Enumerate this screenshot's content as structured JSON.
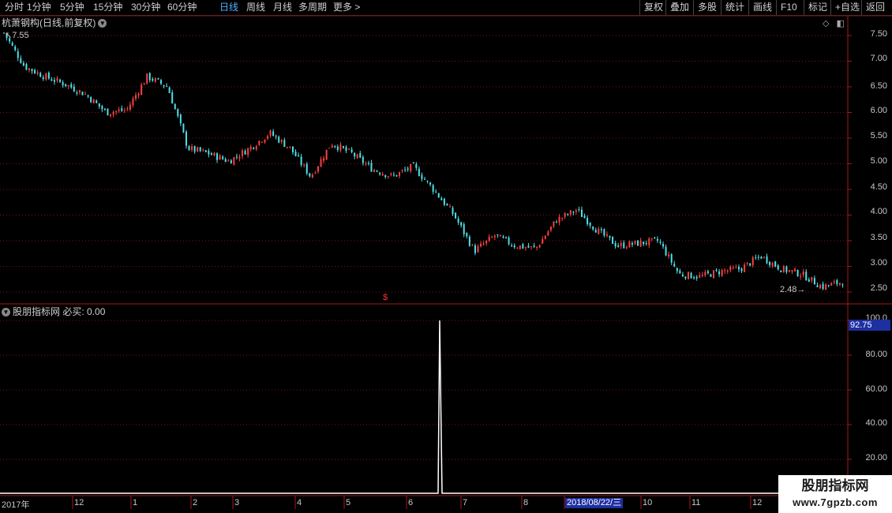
{
  "toolbar": {
    "periods": [
      "分时",
      "1分钟",
      "5分钟",
      "15分钟",
      "30分钟",
      "60分钟",
      "日线",
      "周线",
      "月线",
      "多周期",
      "更多 >"
    ],
    "active_period": "日线",
    "right_buttons": [
      "复权",
      "叠加",
      "多股",
      "统计",
      "画线",
      "F10",
      "标记",
      "+自选",
      "返回"
    ]
  },
  "main_chart": {
    "title": "杭萧钢构(日线,前复权)",
    "high_label": "7.55",
    "low_label": "2.48",
    "price_ticks": [
      "7.50",
      "7.00",
      "6.50",
      "6.00",
      "5.50",
      "5.00",
      "4.50",
      "4.00",
      "3.50",
      "3.00",
      "2.50"
    ],
    "marker": "$"
  },
  "indicator": {
    "title": "股朋指标网",
    "param": "必买: 0.00",
    "current_value": "92.75",
    "ticks": [
      "100.0",
      "80.00",
      "60.00",
      "40.00",
      "20.00"
    ]
  },
  "date_axis": {
    "labels": [
      "2017年",
      "12",
      "1",
      "2",
      "3",
      "4",
      "5",
      "6",
      "7",
      "8",
      "10",
      "11",
      "12"
    ],
    "highlight": "2018/08/22/三"
  },
  "watermark": {
    "line1": "股朋指标网",
    "line2": "www.7gpzb.com"
  },
  "colors": {
    "up": "#ff4040",
    "down": "#4fe0e8",
    "grid": "#7a1414",
    "highlight": "#1e2fa0"
  },
  "chart_data": {
    "type": "candlestick",
    "title": "杭萧钢构(日线,前复权)",
    "price_range": [
      2.3,
      7.75
    ],
    "series_close_path": [
      {
        "date": "2017-11",
        "close": 7.55
      },
      {
        "date": "2017-11",
        "close": 6.9
      },
      {
        "date": "2017-11",
        "close": 6.7
      },
      {
        "date": "2017-12",
        "close": 6.55
      },
      {
        "date": "2017-12",
        "close": 6.35
      },
      {
        "date": "2017-12",
        "close": 6.0
      },
      {
        "date": "2018-01",
        "close": 6.05
      },
      {
        "date": "2018-01",
        "close": 6.7
      },
      {
        "date": "2018-01",
        "close": 6.5
      },
      {
        "date": "2018-02",
        "close": 5.3
      },
      {
        "date": "2018-02",
        "close": 5.2
      },
      {
        "date": "2018-02",
        "close": 5.05
      },
      {
        "date": "2018-03",
        "close": 5.3
      },
      {
        "date": "2018-03",
        "close": 5.6
      },
      {
        "date": "2018-03",
        "close": 5.3
      },
      {
        "date": "2018-04",
        "close": 4.75
      },
      {
        "date": "2018-04",
        "close": 5.4
      },
      {
        "date": "2018-04",
        "close": 5.2
      },
      {
        "date": "2018-05",
        "close": 4.9
      },
      {
        "date": "2018-05",
        "close": 4.75
      },
      {
        "date": "2018-05",
        "close": 4.95
      },
      {
        "date": "2018-06",
        "close": 4.5
      },
      {
        "date": "2018-06",
        "close": 4.0
      },
      {
        "date": "2018-06",
        "close": 3.3
      },
      {
        "date": "2018-07",
        "close": 3.6
      },
      {
        "date": "2018-07",
        "close": 3.4
      },
      {
        "date": "2018-07",
        "close": 3.35
      },
      {
        "date": "2018-08",
        "close": 3.9
      },
      {
        "date": "2018-08",
        "close": 4.1
      },
      {
        "date": "2018-08",
        "close": 3.7
      },
      {
        "date": "2018-09",
        "close": 3.4
      },
      {
        "date": "2018-09",
        "close": 3.45
      },
      {
        "date": "2018-09",
        "close": 3.5
      },
      {
        "date": "2018-10",
        "close": 2.85
      },
      {
        "date": "2018-10",
        "close": 2.8
      },
      {
        "date": "2018-10",
        "close": 2.9
      },
      {
        "date": "2018-11",
        "close": 2.95
      },
      {
        "date": "2018-11",
        "close": 3.2
      },
      {
        "date": "2018-11",
        "close": 2.95
      },
      {
        "date": "2018-12",
        "close": 2.85
      },
      {
        "date": "2018-12",
        "close": 2.6
      },
      {
        "date": "2018-12",
        "close": 2.7
      }
    ],
    "indicator_series": {
      "name": "必买",
      "spike_value": 100,
      "baseline": 0
    }
  }
}
